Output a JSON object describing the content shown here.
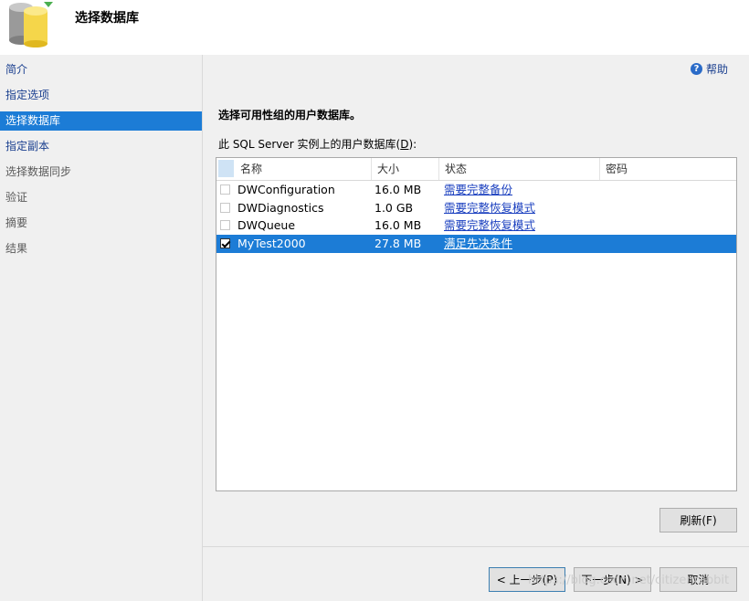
{
  "header": {
    "title": "选择数据库",
    "icon": "database-cylinder-icon"
  },
  "nav": {
    "items": [
      {
        "label": "简介",
        "state": "link"
      },
      {
        "label": "指定选项",
        "state": "link"
      },
      {
        "label": "选择数据库",
        "state": "selected"
      },
      {
        "label": "指定副本",
        "state": "link"
      },
      {
        "label": "选择数据同步",
        "state": "muted"
      },
      {
        "label": "验证",
        "state": "muted"
      },
      {
        "label": "摘要",
        "state": "muted"
      },
      {
        "label": "结果",
        "state": "muted"
      }
    ]
  },
  "main": {
    "help_label": "帮助",
    "heading": "选择可用性组的用户数据库。",
    "sublabel_prefix": "此 SQL Server 实例上的用户数据库(",
    "sublabel_key": "D",
    "sublabel_suffix": "):",
    "grid": {
      "columns": [
        "名称",
        "大小",
        "状态",
        "密码"
      ],
      "rows": [
        {
          "checked": false,
          "name": "DWConfiguration",
          "size": "16.0 MB",
          "status": "需要完整备份",
          "password": "",
          "selected": false
        },
        {
          "checked": false,
          "name": "DWDiagnostics",
          "size": "1.0 GB",
          "status": "需要完整恢复模式",
          "password": "",
          "selected": false
        },
        {
          "checked": false,
          "name": "DWQueue",
          "size": "16.0 MB",
          "status": "需要完整恢复模式",
          "password": "",
          "selected": false
        },
        {
          "checked": true,
          "name": "MyTest2000",
          "size": "27.8 MB",
          "status": "满足先决条件",
          "password": "",
          "selected": true
        }
      ]
    },
    "refresh_label": "刷新(F)"
  },
  "footer": {
    "back_label": "< 上一步(P)",
    "next_label": "下一步(N) >",
    "cancel_label": "取消"
  },
  "watermark": "https://blog.csdn.net/citizenrabbit",
  "colors": {
    "selection": "#1c7cd6",
    "link": "#1a3fbf",
    "nav_link": "#1a3f8f"
  }
}
